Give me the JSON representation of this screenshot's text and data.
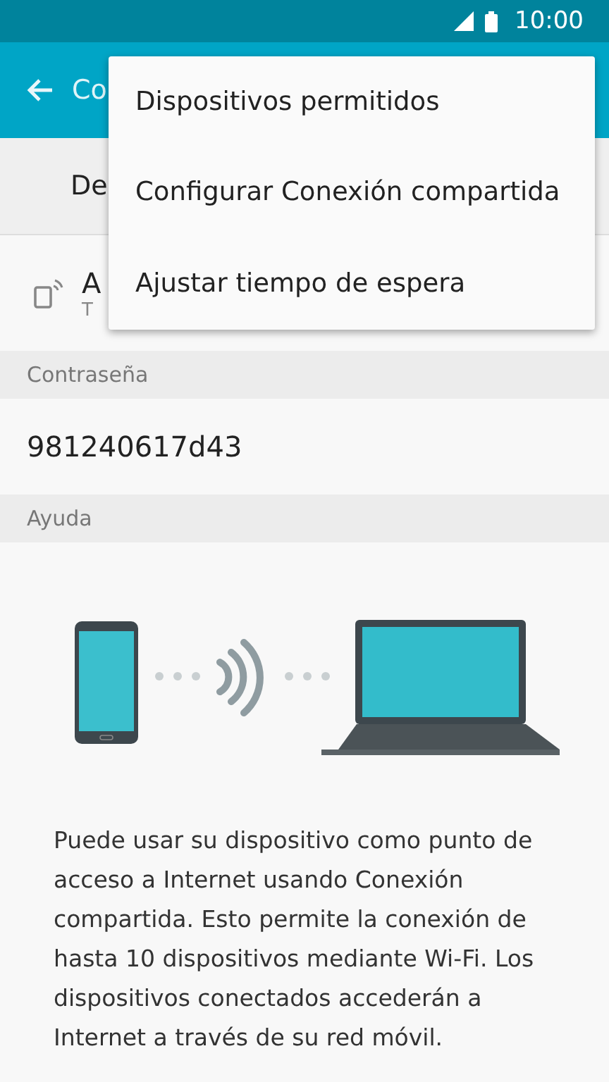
{
  "status_bar": {
    "time": "10:00"
  },
  "app_bar": {
    "title": "Co"
  },
  "tab": {
    "label": "De"
  },
  "hotspot_row": {
    "title": "A",
    "subtitle": "T"
  },
  "sections": [
    {
      "header": "Contraseña",
      "value": "981240617d43"
    },
    {
      "header": "Ayuda"
    }
  ],
  "help_text": "Puede usar su dispositivo como punto de acceso a Internet usando Conexión compartida. Esto permite la conexión de hasta 10 dispositivos mediante Wi-Fi. Los dispositivos conectados accederán a Internet a través de su red móvil.",
  "menu": {
    "items": [
      {
        "label": "Dispositivos permitidos"
      },
      {
        "label": "Configurar Conexión compartida"
      },
      {
        "label": "Ajustar tiempo de espera"
      }
    ]
  }
}
